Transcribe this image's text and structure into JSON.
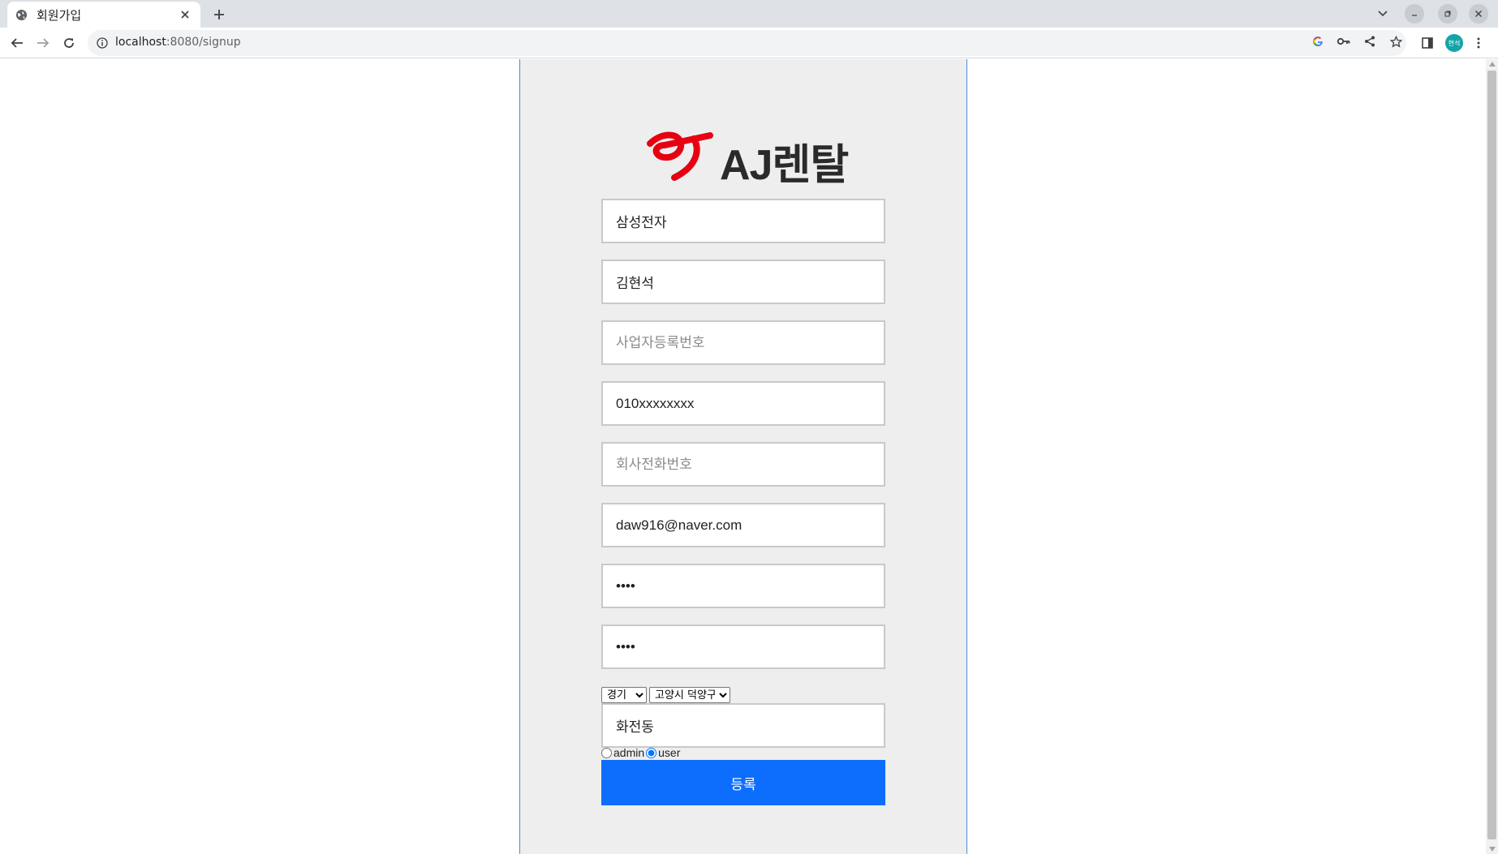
{
  "browser": {
    "tab_title": "회원가입",
    "url_host": "localhost",
    "url_rest": ":8080/signup",
    "profile_initials": "현석"
  },
  "signup": {
    "logo_text": "AJ렌탈",
    "company_name": {
      "value": "삼성전자",
      "placeholder": ""
    },
    "user_name": {
      "value": "김현석",
      "placeholder": ""
    },
    "business_number": {
      "value": "",
      "placeholder": "사업자등록번호"
    },
    "phone": {
      "value": "010xxxxxxxx",
      "placeholder": ""
    },
    "company_phone": {
      "value": "",
      "placeholder": "회사전화번호"
    },
    "email": {
      "value": "daw916@naver.com",
      "placeholder": ""
    },
    "password": {
      "value": "1234"
    },
    "password_confirm": {
      "value": "1234"
    },
    "region_select": {
      "selected": "경기"
    },
    "district_select": {
      "selected": "고양시 덕양구"
    },
    "address_detail": {
      "value": "화전동",
      "placeholder": ""
    },
    "roles": [
      {
        "label": "admin",
        "checked": false
      },
      {
        "label": "user",
        "checked": true
      }
    ],
    "submit_label": "등록"
  },
  "colors": {
    "brand_red": "#e60012",
    "submit_blue": "#0d6efd",
    "card_bg": "#eeeeee",
    "card_border": "#4f8bd6"
  }
}
